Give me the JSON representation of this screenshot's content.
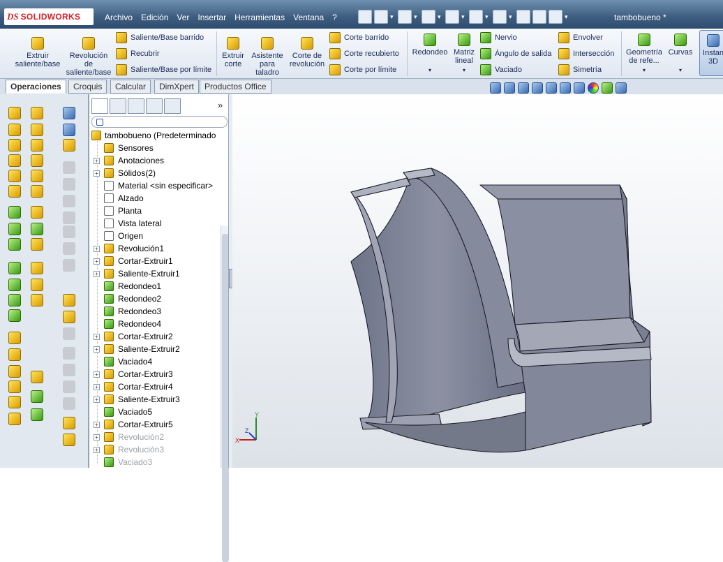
{
  "app": {
    "brand_ds": "DS",
    "brand_name": "SOLIDWORKS",
    "document_title": "tambobueno *"
  },
  "menu": [
    "Archivo",
    "Edición",
    "Ver",
    "Insertar",
    "Herramientas",
    "Ventana",
    "?"
  ],
  "ribbon": {
    "extrude_boss": "Extruir saliente/base",
    "revolve_boss": "Revolución de saliente/base",
    "swept_boss": "Saliente/Base barrido",
    "lofted_boss": "Recubrir",
    "boundary_boss": "Saliente/Base por límite",
    "extruded_cut": "Extruir corte",
    "hole_wizard": "Asistente para taladro",
    "revolved_cut": "Corte de revolución",
    "swept_cut": "Corte barrido",
    "lofted_cut": "Corte recubierto",
    "boundary_cut": "Corte por límite",
    "fillet": "Redondeo",
    "linear_pattern": "Matriz lineal",
    "rib": "Nervio",
    "draft": "Ángulo de salida",
    "shell": "Vaciado",
    "wrap": "Envolver",
    "intersect": "Intersección",
    "mirror": "Simetría",
    "ref_geometry": "Geometría de refe...",
    "curves": "Curvas",
    "instant3d": "Instan 3D"
  },
  "tabs": [
    "Operaciones",
    "Croquis",
    "Calcular",
    "DimXpert",
    "Productos Office"
  ],
  "tree": {
    "root": "tambobueno  (Predeterminado",
    "items": [
      {
        "label": "Sensores",
        "exp": false
      },
      {
        "label": "Anotaciones",
        "exp": true
      },
      {
        "label": "Sólidos(2)",
        "exp": true
      },
      {
        "label": "Material <sin especificar>",
        "exp": false
      },
      {
        "label": "Alzado",
        "exp": false
      },
      {
        "label": "Planta",
        "exp": false
      },
      {
        "label": "Vista lateral",
        "exp": false
      },
      {
        "label": "Origen",
        "exp": false
      },
      {
        "label": "Revolución1",
        "exp": true
      },
      {
        "label": "Cortar-Extruir1",
        "exp": true
      },
      {
        "label": "Saliente-Extruir1",
        "exp": true
      },
      {
        "label": "Redondeo1",
        "exp": false
      },
      {
        "label": "Redondeo2",
        "exp": false
      },
      {
        "label": "Redondeo3",
        "exp": false
      },
      {
        "label": "Redondeo4",
        "exp": false
      },
      {
        "label": "Cortar-Extruir2",
        "exp": true
      },
      {
        "label": "Saliente-Extruir2",
        "exp": true
      },
      {
        "label": "Vaciado4",
        "exp": false
      },
      {
        "label": "Cortar-Extruir3",
        "exp": true
      },
      {
        "label": "Cortar-Extruir4",
        "exp": true
      },
      {
        "label": "Saliente-Extruir3",
        "exp": true
      },
      {
        "label": "Vaciado5",
        "exp": false
      },
      {
        "label": "Cortar-Extruir5",
        "exp": true
      },
      {
        "label": "Revolución2",
        "exp": true,
        "dim": true
      },
      {
        "label": "Revolución3",
        "exp": true,
        "dim": true
      },
      {
        "label": "Vaciado3",
        "exp": false,
        "dim": true
      }
    ]
  },
  "triad": {
    "x": "X",
    "y": "Y",
    "z": "Z"
  }
}
